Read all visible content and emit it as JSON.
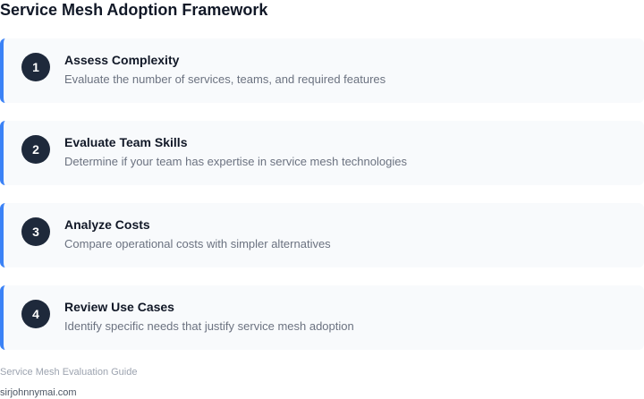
{
  "title": "Service Mesh Adoption Framework",
  "steps": [
    {
      "number": "1",
      "title": "Assess Complexity",
      "description": "Evaluate the number of services, teams, and required features"
    },
    {
      "number": "2",
      "title": "Evaluate Team Skills",
      "description": "Determine if your team has expertise in service mesh technologies"
    },
    {
      "number": "3",
      "title": "Analyze Costs",
      "description": "Compare operational costs with simpler alternatives"
    },
    {
      "number": "4",
      "title": "Review Use Cases",
      "description": "Identify specific needs that justify service mesh adoption"
    }
  ],
  "footer": {
    "caption": "Service Mesh Evaluation Guide",
    "site": "sirjohnnymai.com"
  },
  "colors": {
    "accent": "#3b82f6",
    "badge": "#1e293b",
    "card_bg": "#f8fafc"
  }
}
